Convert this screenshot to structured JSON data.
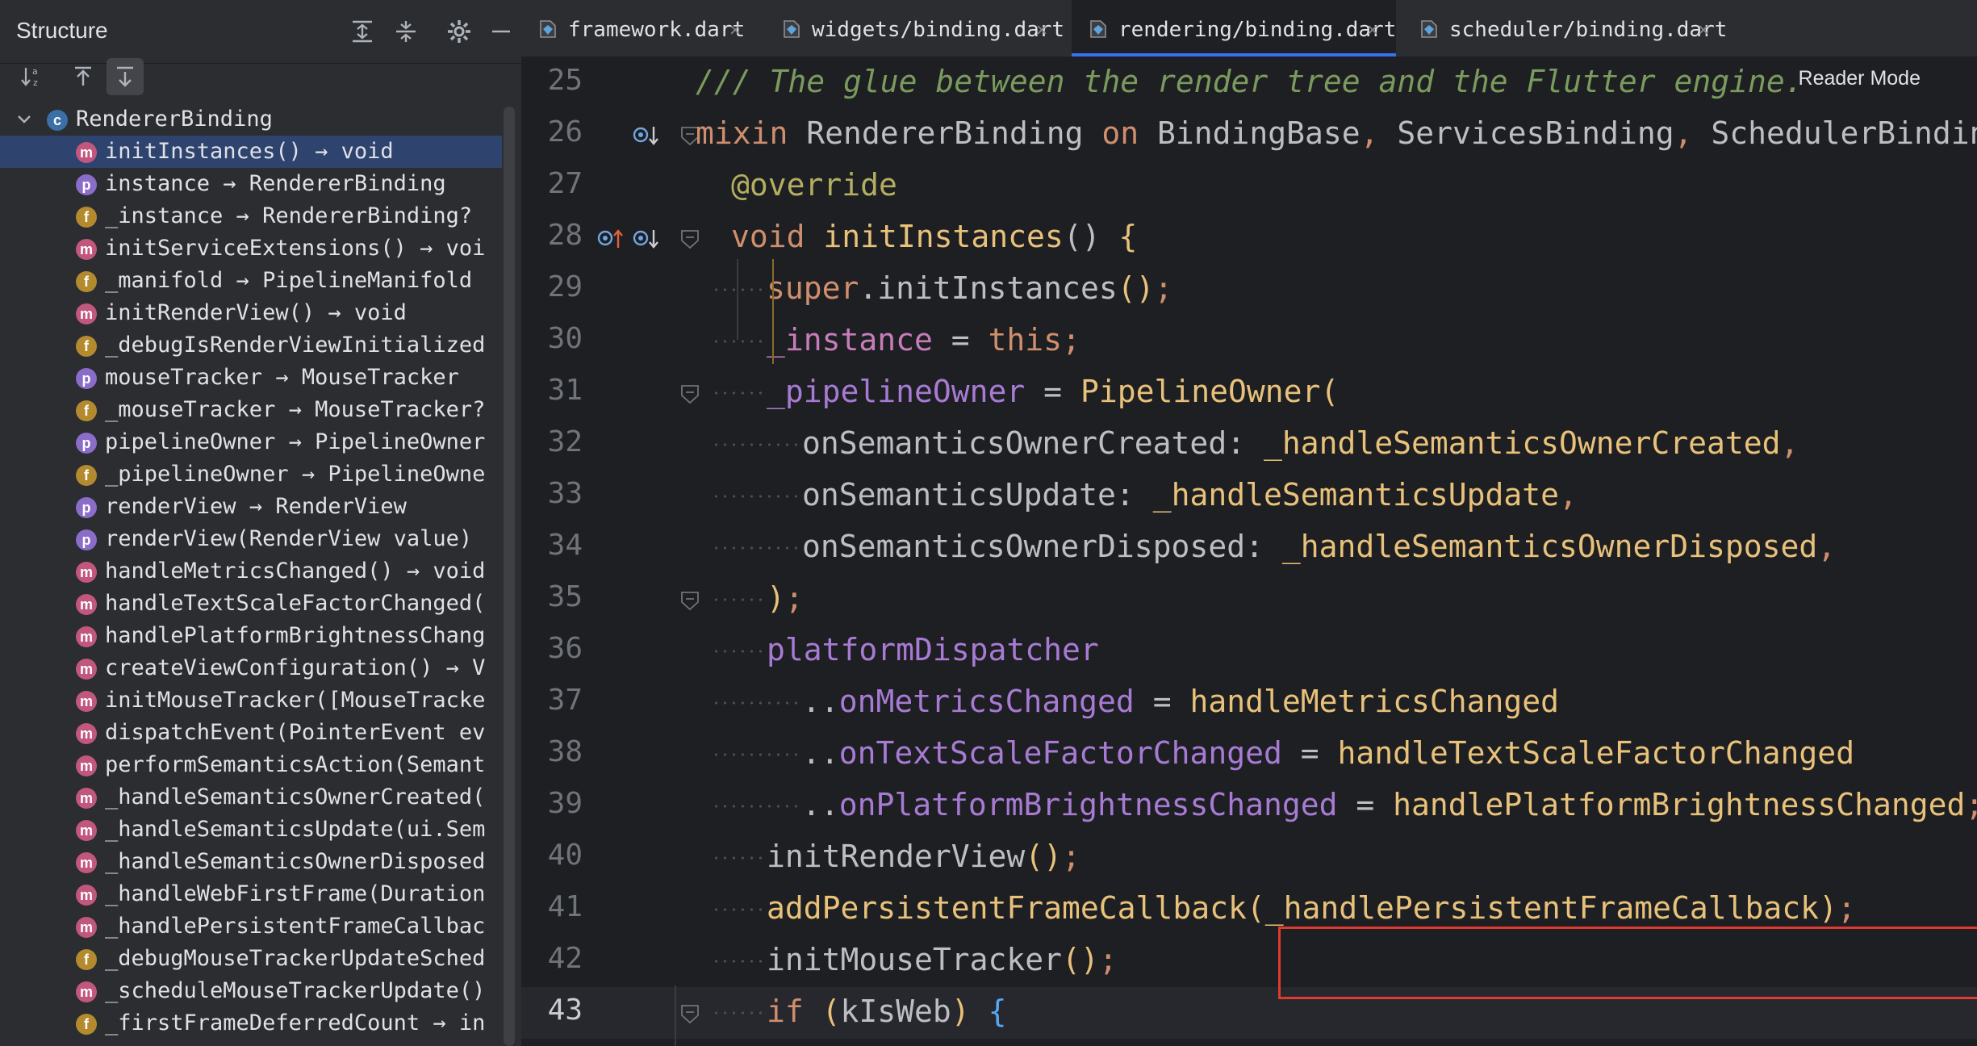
{
  "structure": {
    "title": "Structure",
    "items": [
      {
        "badge": "c",
        "label": "RendererBinding",
        "root": true
      },
      {
        "badge": "m",
        "label": "initInstances() → void",
        "selected": true
      },
      {
        "badge": "p",
        "label": "instance → RendererBinding"
      },
      {
        "badge": "f",
        "label": "_instance → RendererBinding?"
      },
      {
        "badge": "m",
        "label": "initServiceExtensions() → voi"
      },
      {
        "badge": "f",
        "label": "_manifold → PipelineManifold"
      },
      {
        "badge": "m",
        "label": "initRenderView() → void"
      },
      {
        "badge": "f",
        "label": "_debugIsRenderViewInitialized"
      },
      {
        "badge": "p",
        "label": "mouseTracker → MouseTracker"
      },
      {
        "badge": "f",
        "label": "_mouseTracker → MouseTracker?"
      },
      {
        "badge": "p",
        "label": "pipelineOwner → PipelineOwner"
      },
      {
        "badge": "f",
        "label": "_pipelineOwner → PipelineOwne"
      },
      {
        "badge": "p",
        "label": "renderView → RenderView"
      },
      {
        "badge": "p",
        "label": "renderView(RenderView value)"
      },
      {
        "badge": "m",
        "label": "handleMetricsChanged() → void"
      },
      {
        "badge": "m",
        "label": "handleTextScaleFactorChanged("
      },
      {
        "badge": "m",
        "label": "handlePlatformBrightnessChang"
      },
      {
        "badge": "m",
        "label": "createViewConfiguration() → V"
      },
      {
        "badge": "m",
        "label": "initMouseTracker([MouseTracke"
      },
      {
        "badge": "m",
        "label": "dispatchEvent(PointerEvent ev"
      },
      {
        "badge": "m",
        "label": "performSemanticsAction(Semant"
      },
      {
        "badge": "m",
        "label": "_handleSemanticsOwnerCreated("
      },
      {
        "badge": "m",
        "label": "_handleSemanticsUpdate(ui.Sem"
      },
      {
        "badge": "m",
        "label": "_handleSemanticsOwnerDisposed"
      },
      {
        "badge": "m",
        "label": "_handleWebFirstFrame(Duration"
      },
      {
        "badge": "m",
        "label": "_handlePersistentFrameCallbac"
      },
      {
        "badge": "f",
        "label": "_debugMouseTrackerUpdateSched"
      },
      {
        "badge": "m",
        "label": "_scheduleMouseTrackerUpdate()"
      },
      {
        "badge": "f",
        "label": "_firstFrameDeferredCount → in"
      }
    ]
  },
  "tabs": [
    {
      "label": "framework.dart",
      "close": "×"
    },
    {
      "label": "widgets/binding.dart",
      "close": "×"
    },
    {
      "label": "rendering/binding.dart",
      "close": "×",
      "active": true
    },
    {
      "label": "scheduler/binding.dart",
      "close": "×"
    }
  ],
  "editor": {
    "reader_mode": "Reader Mode",
    "current_line": "43",
    "lines": [
      {
        "n": "25",
        "indent": 0,
        "tokens": [
          [
            "cm",
            "/// The glue between the render tree and the Flutter engine."
          ]
        ]
      },
      {
        "n": "26",
        "indent": 0,
        "tokens": [
          [
            "kw",
            "mixin "
          ],
          [
            "ty",
            "RendererBinding "
          ],
          [
            "kw",
            "on "
          ],
          [
            "ty",
            "BindingBase"
          ],
          [
            "kw",
            ", "
          ],
          [
            "ty",
            "ServicesBinding"
          ],
          [
            "kw",
            ", "
          ],
          [
            "ty",
            "SchedulerBinding"
          ],
          [
            "kw",
            ","
          ]
        ]
      },
      {
        "n": "27",
        "indent": 1,
        "tokens": [
          [
            "ann",
            "@override"
          ]
        ]
      },
      {
        "n": "28",
        "indent": 1,
        "tokens": [
          [
            "kw",
            "void "
          ],
          [
            "yl",
            "initInstances"
          ],
          [
            "nm",
            "() "
          ],
          [
            "yl",
            "{"
          ]
        ]
      },
      {
        "n": "29",
        "indent": 2,
        "tokens": [
          [
            "kw",
            "super"
          ],
          [
            "nm",
            "."
          ],
          [
            "nm",
            "initInstances"
          ],
          [
            "yl",
            "()"
          ],
          [
            "kw",
            ";"
          ]
        ]
      },
      {
        "n": "30",
        "indent": 2,
        "tokens": [
          [
            "pr",
            "_instance"
          ],
          [
            "nm",
            " = "
          ],
          [
            "kw",
            "this"
          ],
          [
            "kw",
            ";"
          ]
        ]
      },
      {
        "n": "31",
        "indent": 2,
        "tokens": [
          [
            "pu",
            "_pipelineOwner"
          ],
          [
            "nm",
            " = "
          ],
          [
            "yl",
            "PipelineOwner("
          ]
        ]
      },
      {
        "n": "32",
        "indent": 3,
        "tokens": [
          [
            "nm",
            "onSemanticsOwnerCreated: "
          ],
          [
            "yl",
            "_handleSemanticsOwnerCreated"
          ],
          [
            "kw",
            ","
          ]
        ]
      },
      {
        "n": "33",
        "indent": 3,
        "tokens": [
          [
            "nm",
            "onSemanticsUpdate: "
          ],
          [
            "yl",
            "_handleSemanticsUpdate"
          ],
          [
            "kw",
            ","
          ]
        ]
      },
      {
        "n": "34",
        "indent": 3,
        "tokens": [
          [
            "nm",
            "onSemanticsOwnerDisposed: "
          ],
          [
            "yl",
            "_handleSemanticsOwnerDisposed"
          ],
          [
            "kw",
            ","
          ]
        ]
      },
      {
        "n": "35",
        "indent": 2,
        "tokens": [
          [
            "yl",
            ")"
          ],
          [
            "kw",
            ";"
          ]
        ]
      },
      {
        "n": "36",
        "indent": 2,
        "tokens": [
          [
            "pu",
            "platformDispatcher"
          ]
        ]
      },
      {
        "n": "37",
        "indent": 3,
        "tokens": [
          [
            "nm",
            ".."
          ],
          [
            "pu",
            "onMetricsChanged"
          ],
          [
            "nm",
            " = "
          ],
          [
            "yl",
            "handleMetricsChanged"
          ]
        ]
      },
      {
        "n": "38",
        "indent": 3,
        "tokens": [
          [
            "nm",
            ".."
          ],
          [
            "pu",
            "onTextScaleFactorChanged"
          ],
          [
            "nm",
            " = "
          ],
          [
            "yl",
            "handleTextScaleFactorChanged"
          ]
        ]
      },
      {
        "n": "39",
        "indent": 3,
        "tokens": [
          [
            "nm",
            ".."
          ],
          [
            "pu",
            "onPlatformBrightnessChanged"
          ],
          [
            "nm",
            " = "
          ],
          [
            "yl",
            "handlePlatformBrightnessChanged"
          ],
          [
            "kw",
            ";"
          ]
        ]
      },
      {
        "n": "40",
        "indent": 2,
        "tokens": [
          [
            "nm",
            "initRenderView"
          ],
          [
            "yl",
            "()"
          ],
          [
            "kw",
            ";"
          ]
        ]
      },
      {
        "n": "41",
        "indent": 2,
        "tokens": [
          [
            "yl",
            "addPersistentFrameCallback("
          ],
          [
            "yl",
            "_handlePersistentFrameCallback"
          ],
          [
            "yl",
            ")"
          ],
          [
            "kw",
            ";"
          ]
        ]
      },
      {
        "n": "42",
        "indent": 2,
        "tokens": [
          [
            "nm",
            "initMouseTracker"
          ],
          [
            "yl",
            "()"
          ],
          [
            "kw",
            ";"
          ]
        ]
      },
      {
        "n": "43",
        "indent": 2,
        "tokens": [
          [
            "kw",
            "if "
          ],
          [
            "yl",
            "("
          ],
          [
            "nm",
            "kIsWeb"
          ],
          [
            "yl",
            ") "
          ],
          [
            "fn",
            "{"
          ]
        ]
      }
    ]
  },
  "colors": {
    "accent": "#3574f0",
    "highlight_box": "#e0392f",
    "selected_row": "#2e436e"
  }
}
